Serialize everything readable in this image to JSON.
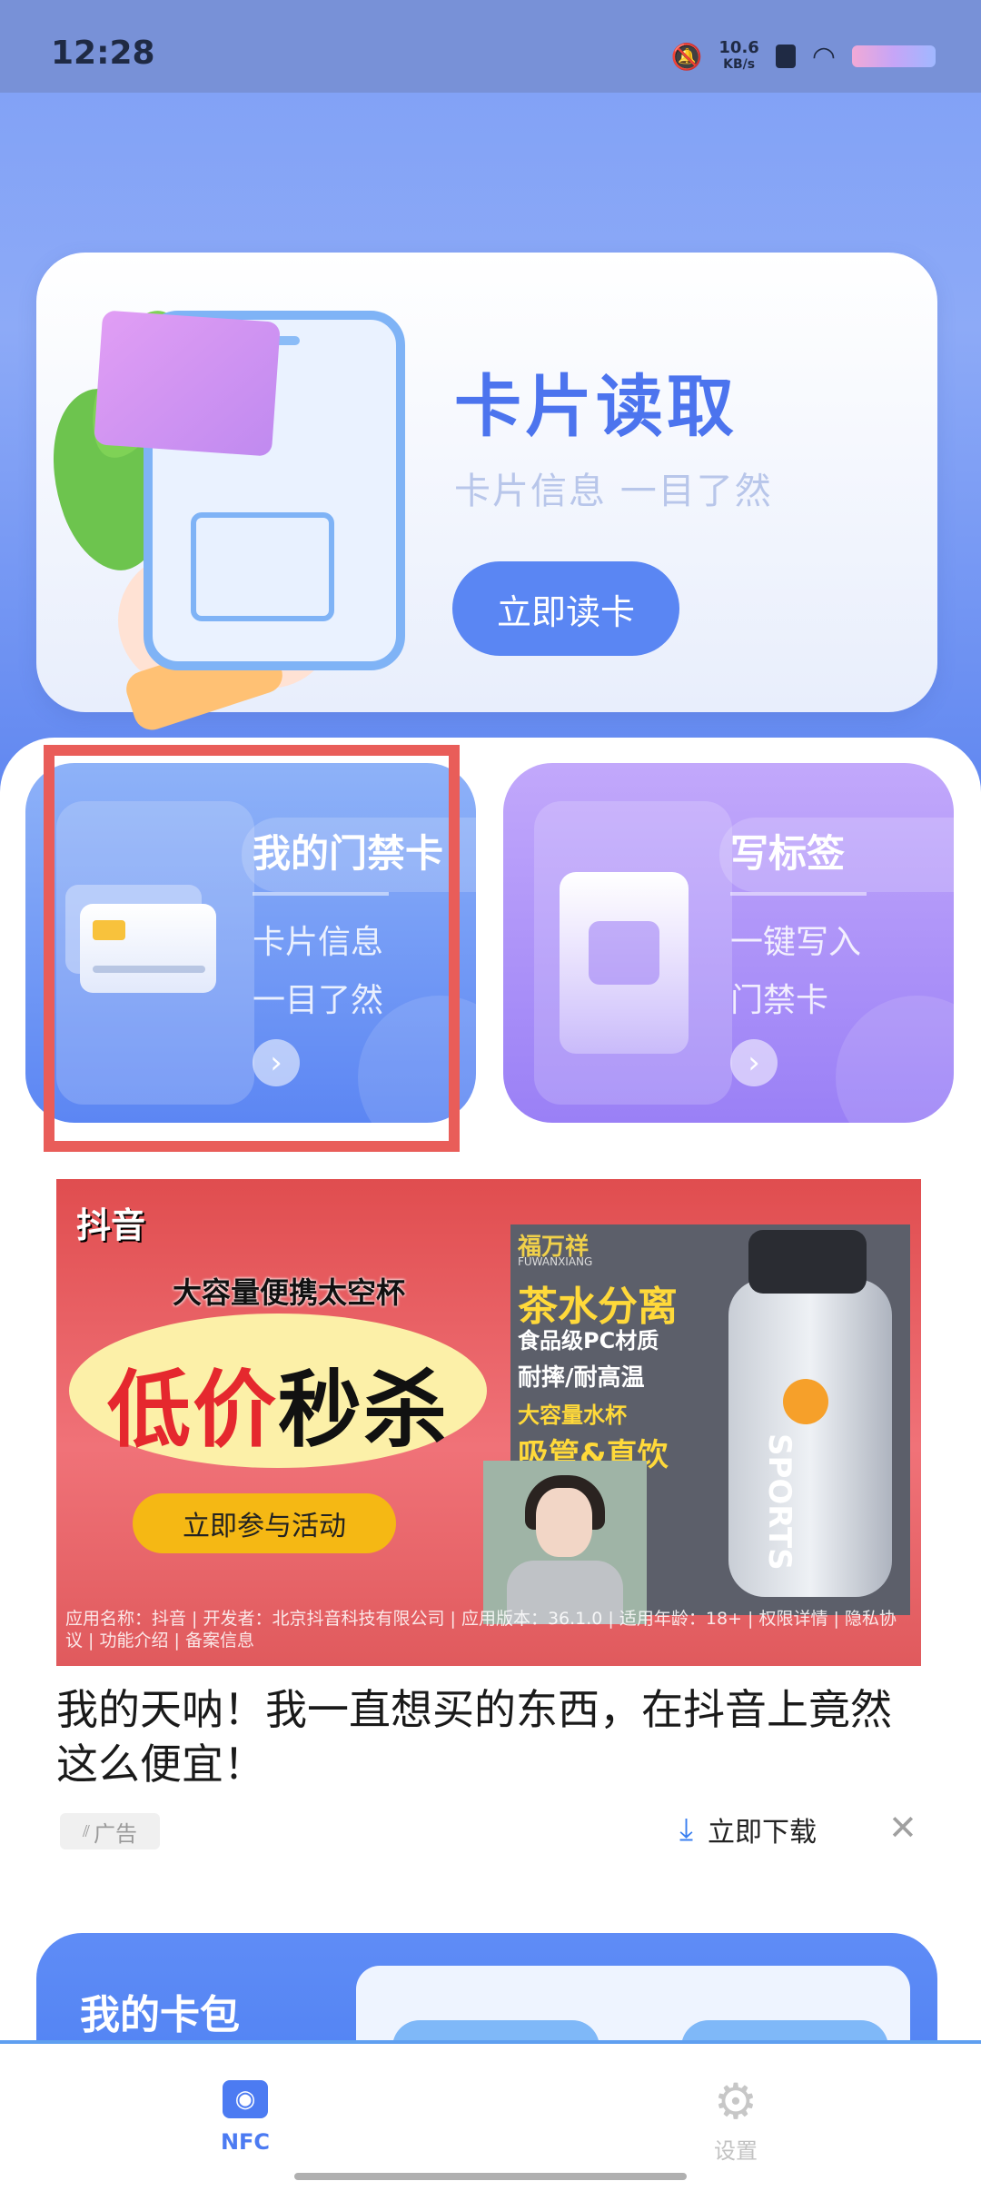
{
  "status_bar": {
    "time": "12:28",
    "speed_value": "10.6",
    "speed_unit": "KB/s"
  },
  "read_card": {
    "title": "卡片读取",
    "subtitle": "卡片信息  一目了然",
    "button": "立即读卡"
  },
  "features": [
    {
      "title": "我的门禁卡",
      "line1": "卡片信息",
      "line2": "一目了然"
    },
    {
      "title": "写标签",
      "line1": "一键写入",
      "line2": "门禁卡"
    }
  ],
  "ad": {
    "logo": "抖音",
    "image_subtitle": "大容量便携太空杯",
    "big_red": "低价",
    "big_black": "秒杀",
    "cta": "立即参与活动",
    "brand": "福万祥",
    "brand_en": "FUWANXIANG",
    "tea": "茶水分离",
    "pc": "食品级PC材质",
    "heat": "耐摔/耐高温",
    "capacity": "大容量水杯",
    "straw": "吸管&直饮",
    "bottle_text": "SPORTS",
    "disclaimer": "应用名称：抖音 | 开发者：北京抖音科技有限公司 | 应用版本：36.1.0 | 适用年龄：18+ | 权限详情 | 隐私协议 | 功能介绍 | 备案信息",
    "headline": "我的天呐！我一直想买的东西，在抖音上竟然这么便宜！",
    "tag": "广告",
    "download": "立即下载"
  },
  "wallet": {
    "title": "我的卡包"
  },
  "bottom_nav": {
    "nfc": "NFC",
    "settings": "设置"
  },
  "colors": {
    "accent": "#4c7bf2",
    "highlight": "#e95d59"
  }
}
